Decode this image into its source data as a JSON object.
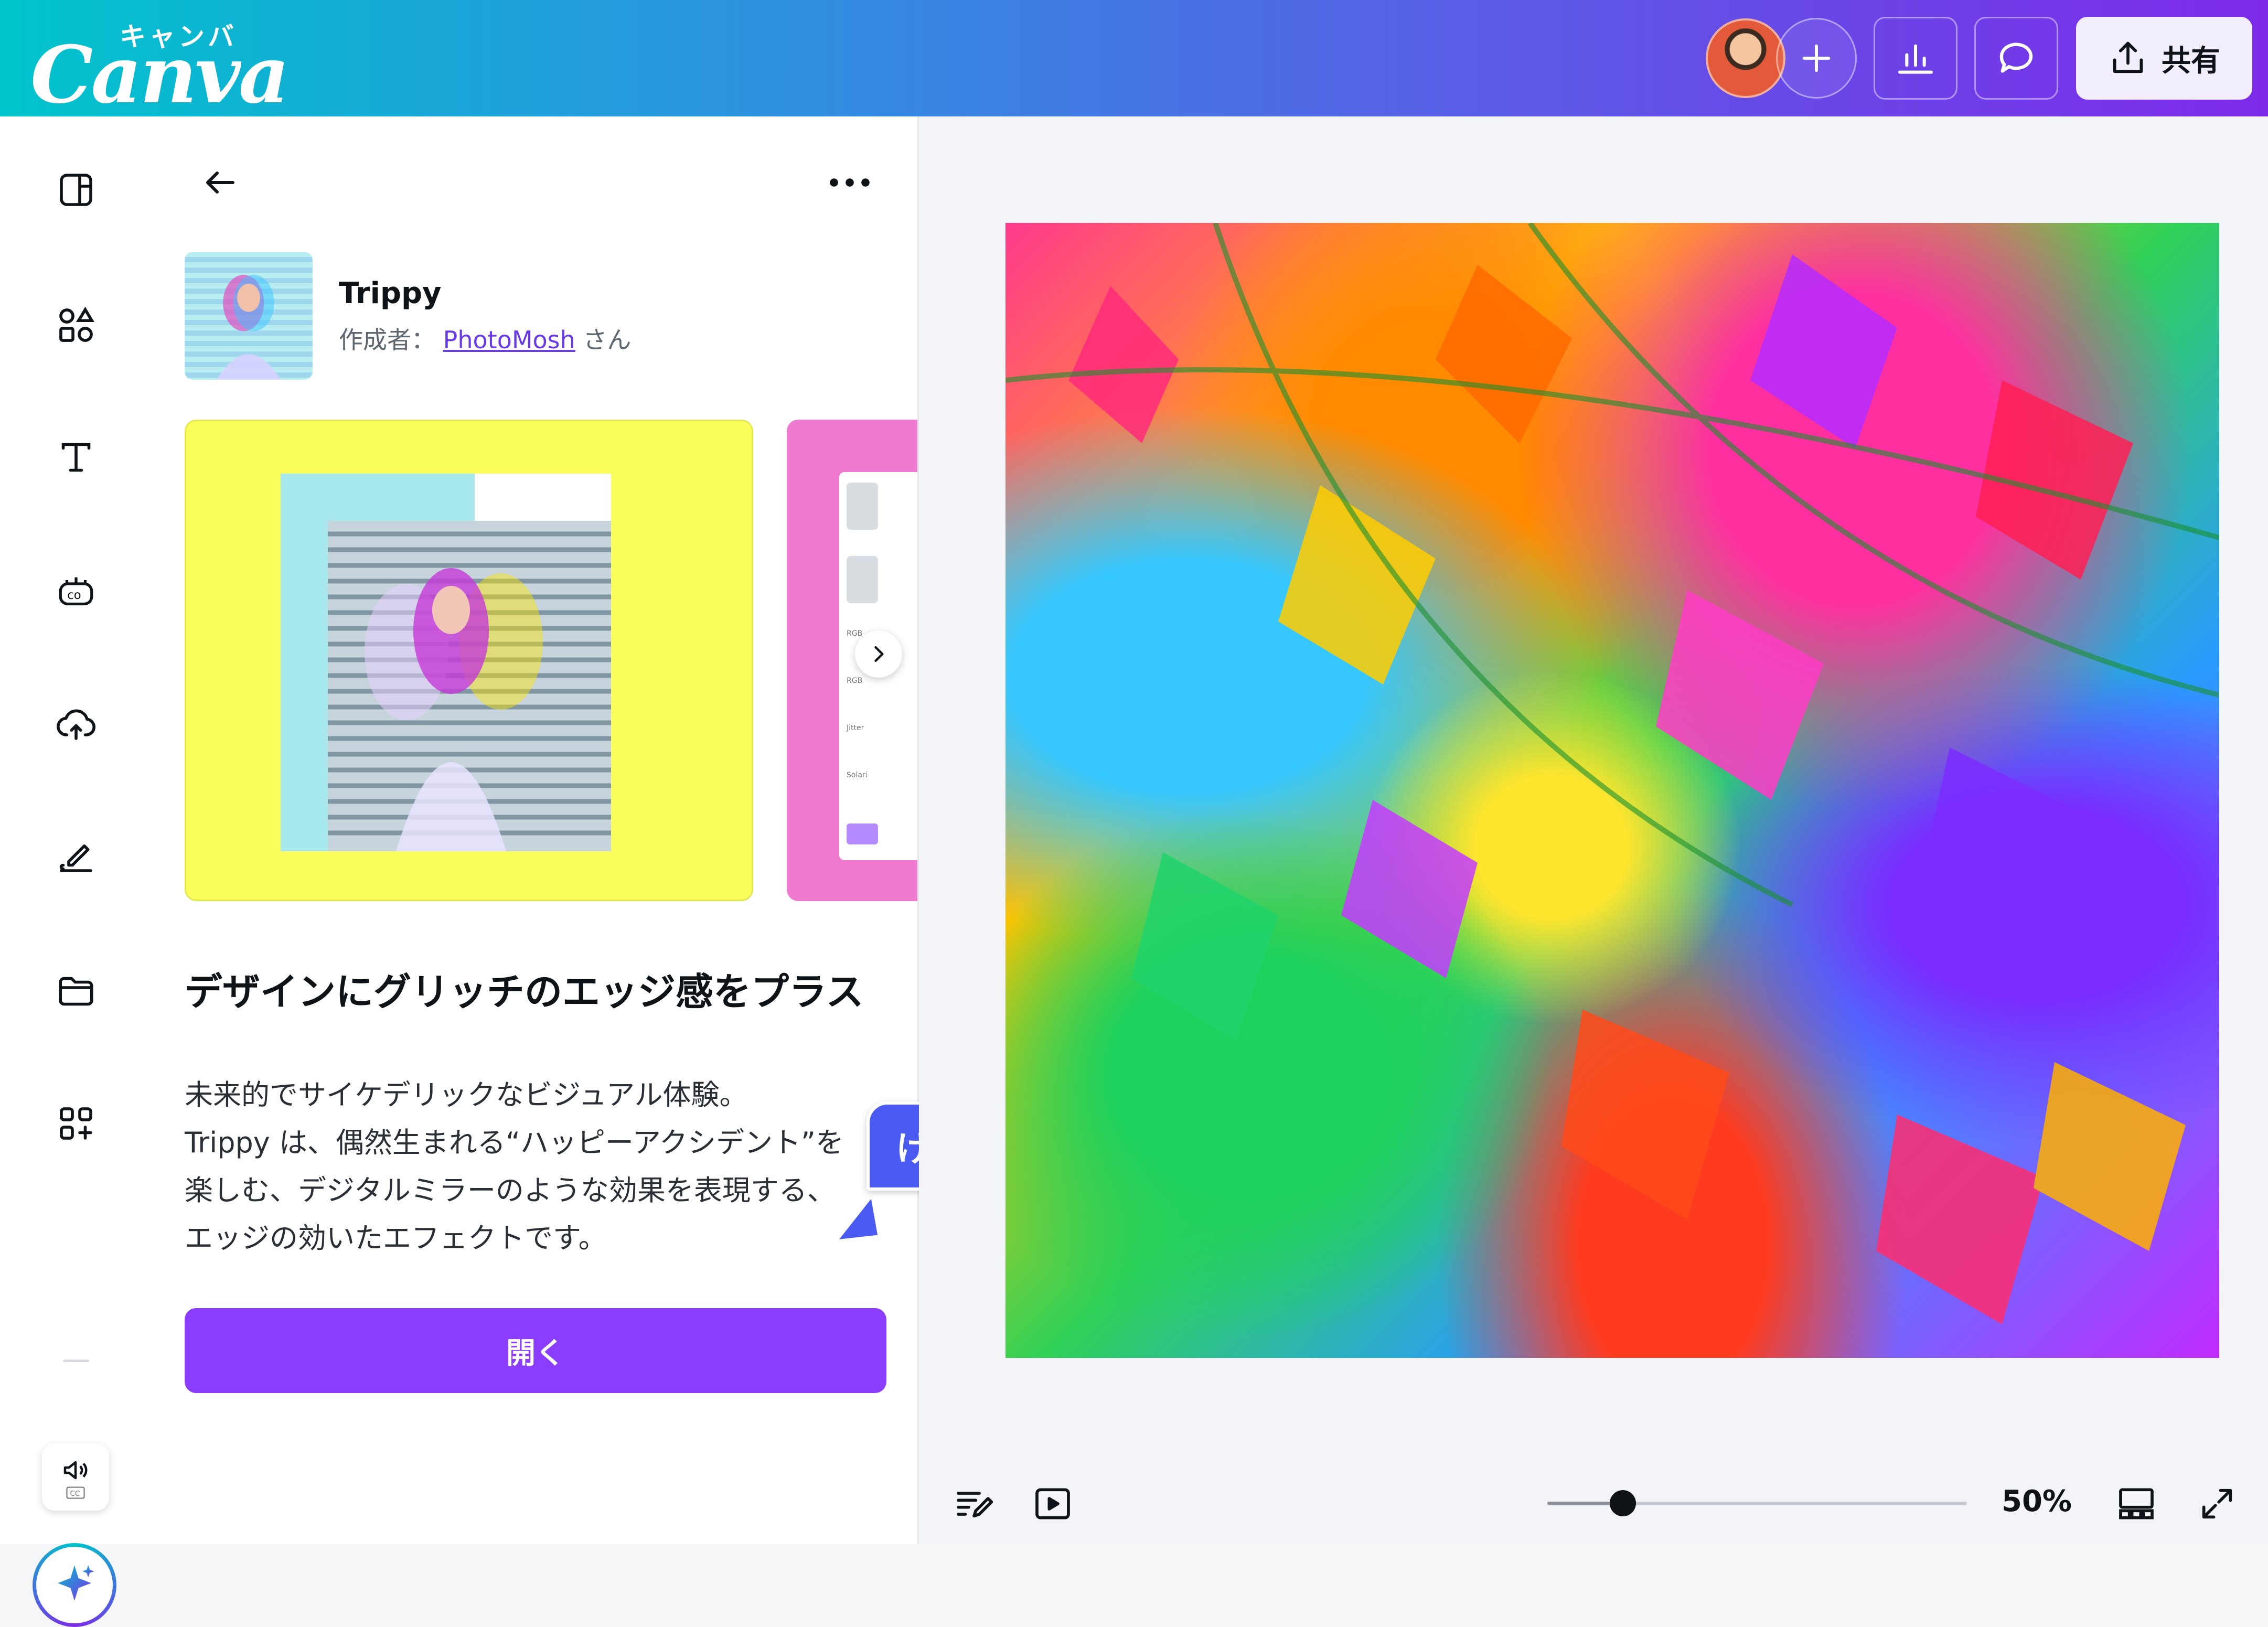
{
  "header": {
    "logo_word": "Canva",
    "logo_kana": "キャンバ",
    "share_label": "共有"
  },
  "rail": {
    "items": [
      "templates",
      "elements",
      "text",
      "brand",
      "uploads",
      "draw",
      "projects",
      "apps"
    ]
  },
  "panel": {
    "app_name": "Trippy",
    "author_prefix": "作成者：",
    "author_name": "PhotoMosh",
    "author_suffix": "さん",
    "headline": "デザインにグリッチのエッジ感をプラス",
    "description": "未来的でサイケデリックなビジュアル体験。\nTrippy は、偶然生まれる“ハッピーアクシデント”を\n楽しむ、デジタルミラーのような効果を表現する、\nエッジの効いたエフェクトです。",
    "open_label": "開く",
    "preview_labels": [
      "RGB",
      "RGB",
      "Jitter",
      "Solari"
    ]
  },
  "collaborator": {
    "name": "けいすけ",
    "color": "#4b5bf2"
  },
  "canvas": {
    "zoom_label": "50%",
    "zoom_level": 0.18
  },
  "colors": {
    "brand_purple": "#8b3dff",
    "header_start": "#00c4cc",
    "header_end": "#7d2ae8"
  }
}
